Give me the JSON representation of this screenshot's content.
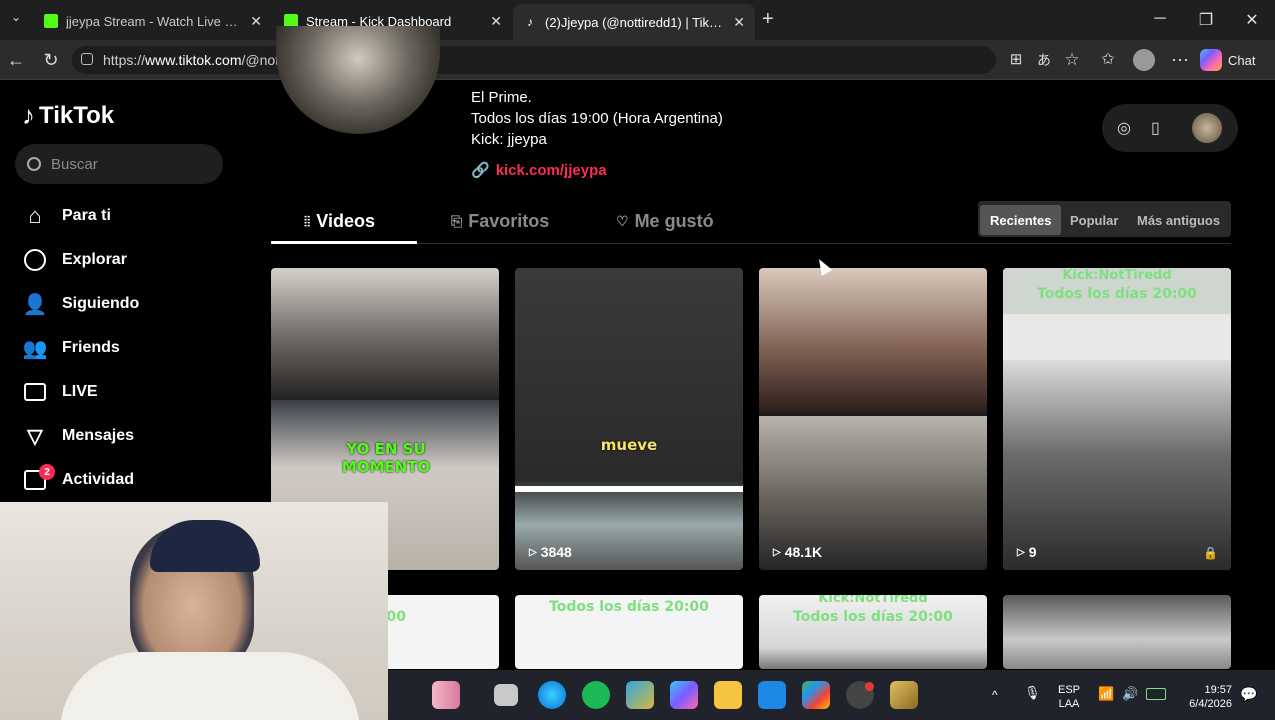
{
  "browser": {
    "tabs": [
      {
        "title": "jjeypa Stream - Watch Live on Kick",
        "active": false,
        "color": "#53fc18"
      },
      {
        "title": "Stream - Kick Dashboard",
        "active": false,
        "color": "#53fc18"
      },
      {
        "title": "(2)Jjeypa (@nottiredd1) | TikTok",
        "active": true,
        "color": "#ffffff"
      }
    ],
    "url_prefix": "https://",
    "url_domain": "www.tiktok.com",
    "url_path": "/@nottiredd1",
    "chat_label": "Chat"
  },
  "sidebar": {
    "logo": "TikTok",
    "search_placeholder": "Buscar",
    "items": [
      {
        "label": "Para ti",
        "icon": "home-icon"
      },
      {
        "label": "Explorar",
        "icon": "compass-icon"
      },
      {
        "label": "Siguiendo",
        "icon": "following-icon"
      },
      {
        "label": "Friends",
        "icon": "friends-icon"
      },
      {
        "label": "LIVE",
        "icon": "live-icon"
      },
      {
        "label": "Mensajes",
        "icon": "messages-icon"
      },
      {
        "label": "Actividad",
        "icon": "activity-icon"
      }
    ],
    "activity_badge": "2"
  },
  "profile": {
    "bio_lines": [
      "El Prime.",
      "Todos los días 19:00 (Hora Argentina)",
      "Kick: jjeypa"
    ],
    "link": "kick.com/jjeypa",
    "tabs": [
      "Videos",
      "Favoritos",
      "Me gustó"
    ],
    "sort": [
      "Recientes",
      "Popular",
      "Más antiguos"
    ]
  },
  "videos": [
    {
      "views": "",
      "caption": "YO EN SU MOMENTO"
    },
    {
      "views": "3848",
      "caption": "mueve"
    },
    {
      "views": "48.1K",
      "caption": ""
    },
    {
      "views": "9",
      "caption_top": "Kick:NotTiredd",
      "caption_bottom": "Todos los días 20:00"
    }
  ],
  "videos_row2": [
    {
      "caption": "días 20:00"
    },
    {
      "caption": "Todos los días 20:00"
    },
    {
      "caption_top": "Kick:NotTiredd",
      "caption_bottom": "Todos los días 20:00"
    },
    {
      "caption": ""
    }
  ],
  "taskbar": {
    "lang_top": "ESP",
    "lang_bottom": "LAA",
    "time": "19:57",
    "date": "6/4/2026"
  },
  "colors": {
    "accent": "#fe2c55",
    "kick": "#53fc18"
  }
}
